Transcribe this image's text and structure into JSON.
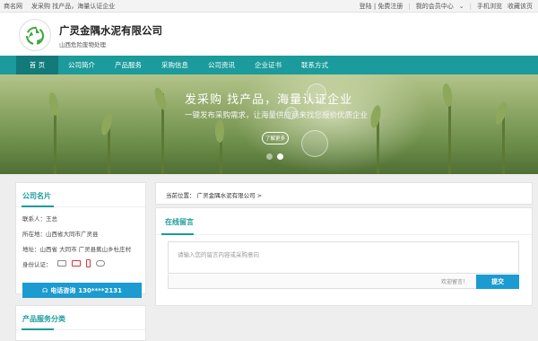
{
  "topbar": {
    "site": "商名网",
    "slogan": "发采购 找产品，海量认证企业",
    "login": "登陆 | 免费注册",
    "member_center": "我的会员中心",
    "mobile": "手机浏览",
    "favorite": "收藏该页"
  },
  "header": {
    "company_name": "广灵金隅水泥有限公司",
    "company_sub": "山西危险废物处理"
  },
  "nav": {
    "items": [
      "首 页",
      "公司简介",
      "产品服务",
      "采购信息",
      "公司资讯",
      "企业证书",
      "联系方式"
    ]
  },
  "banner": {
    "title": "发采购 找产品，海量认证企业",
    "subtitle": "一键发布采购需求，让海量供应商来找您报价优质企业",
    "more": "了解更多"
  },
  "card": {
    "title": "公司名片",
    "contact_label": "联系人：",
    "contact_value": "王总",
    "location_label": "所在地：",
    "location_value": "山西省大同市广灵县",
    "address_label": "地址：",
    "address_value": "山西省 大同市 广灵县蕉山乡杜庄村",
    "id_label": "身份认证：",
    "phone_label": "电话咨询",
    "phone_value": "130****2131"
  },
  "category": {
    "title": "产品服务分类"
  },
  "breadcrumb": {
    "label": "当前位置：",
    "path": "广灵金隅水泥有限公司 >"
  },
  "message": {
    "title": "在线留言",
    "placeholder": "请输入您的留言内容或采购意向",
    "welcome": "欢迎留言！",
    "submit": "提交"
  },
  "colors": {
    "accent": "#1b9b9b",
    "button": "#1b9bcf"
  }
}
